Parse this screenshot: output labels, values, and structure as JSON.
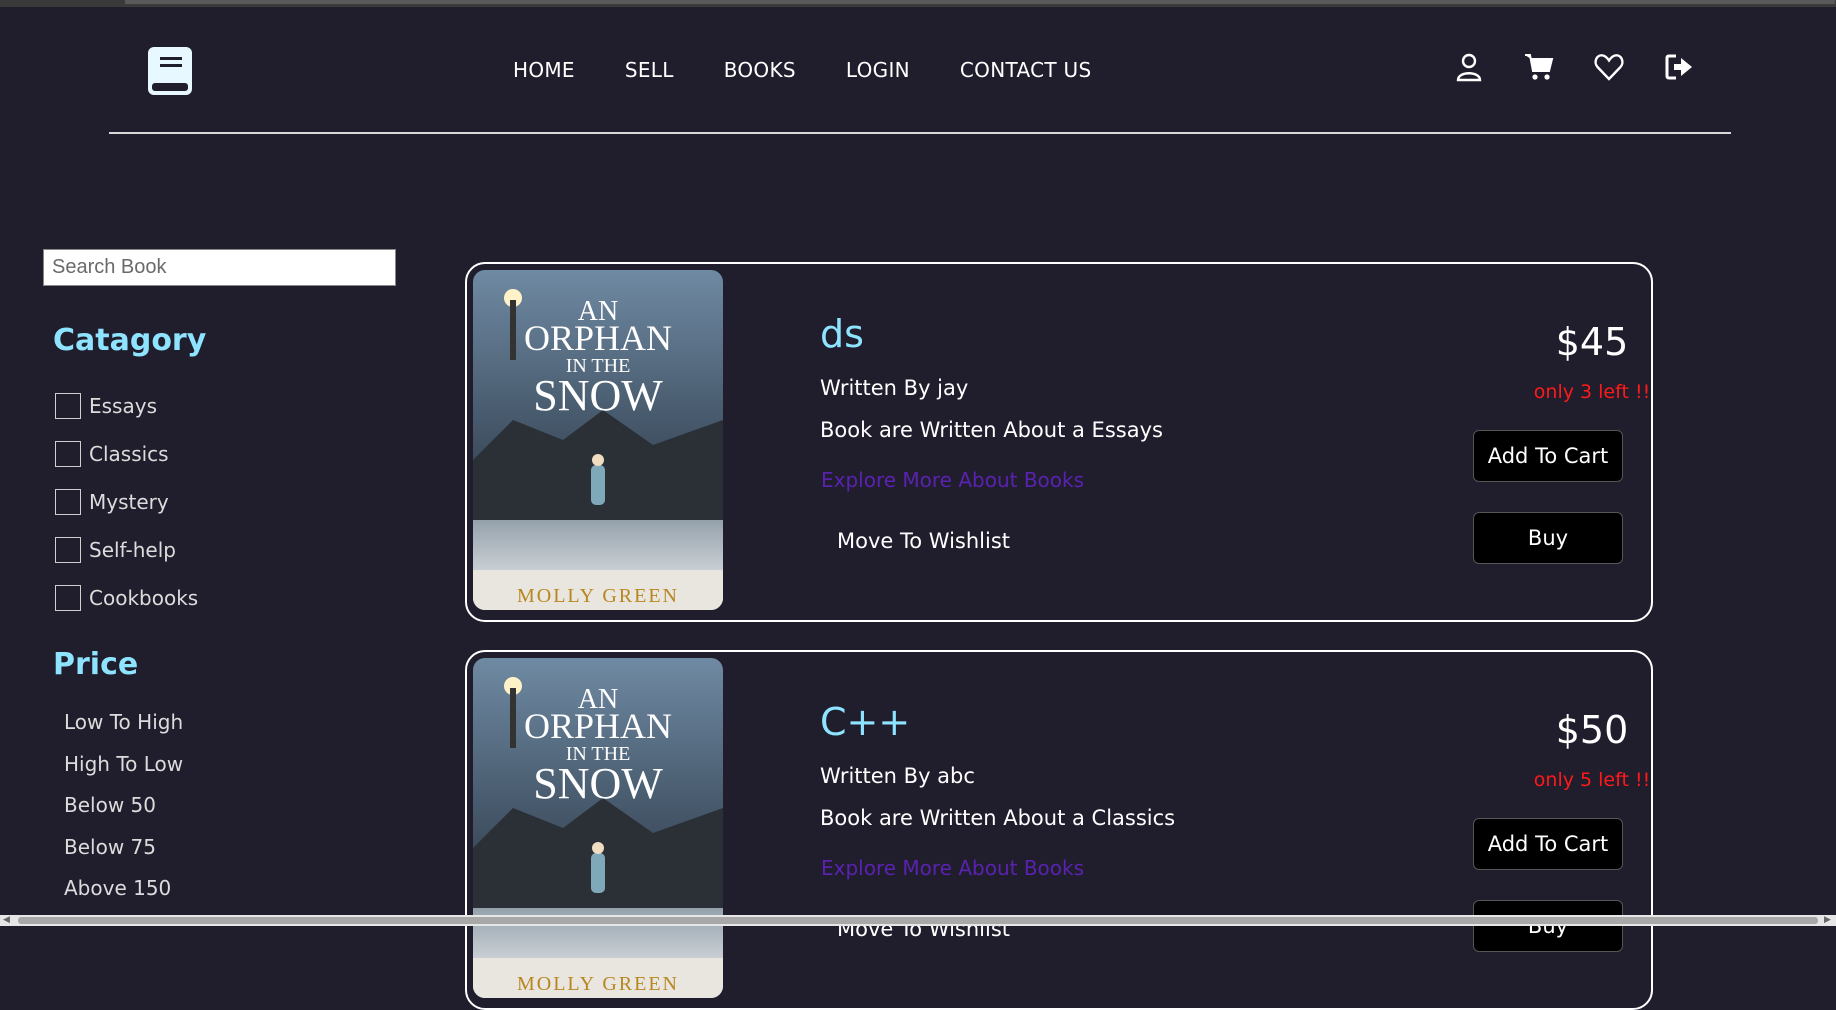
{
  "nav": {
    "items": [
      "HOME",
      "SELL",
      "BOOKS",
      "LOGIN",
      "CONTACT US"
    ]
  },
  "header_icons": [
    "user-icon",
    "cart-icon",
    "heart-icon",
    "logout-icon"
  ],
  "search": {
    "placeholder": "Search Book",
    "value": ""
  },
  "sidebar": {
    "category_heading": "Catagory",
    "categories": [
      "Essays",
      "Classics",
      "Mystery",
      "Self-help",
      "Cookbooks"
    ],
    "price_heading": "Price",
    "price_options": [
      "Low To High",
      "High To Low",
      "Below 50",
      "Below 75",
      "Above 150"
    ]
  },
  "books": [
    {
      "title": "ds",
      "author": "Written By jay",
      "about": "Book are Written About a Essays",
      "explore": "Explore More About Books",
      "wishlist": "Move To Wishlist",
      "price": "$45",
      "stock": "only 3 left !!",
      "add_to_cart": "Add To Cart",
      "buy": "Buy",
      "cover": {
        "line1": "AN",
        "line2": "ORPHAN",
        "line3": "IN THE",
        "line4": "SNOW",
        "author": "MOLLY GREEN"
      }
    },
    {
      "title": "C++",
      "author": "Written By abc",
      "about": "Book are Written About a Classics",
      "explore": "Explore More About Books",
      "wishlist": "Move To Wishlist",
      "price": "$50",
      "stock": "only 5 left !!",
      "add_to_cart": "Add To Cart",
      "buy": "Buy",
      "cover": {
        "line1": "AN",
        "line2": "ORPHAN",
        "line3": "IN THE",
        "line4": "SNOW",
        "author": "MOLLY GREEN"
      }
    }
  ],
  "colors": {
    "background": "#201d2c",
    "accent": "#8ee3ff",
    "link": "#5a22b0",
    "stock_warning": "#ff1a1a"
  }
}
